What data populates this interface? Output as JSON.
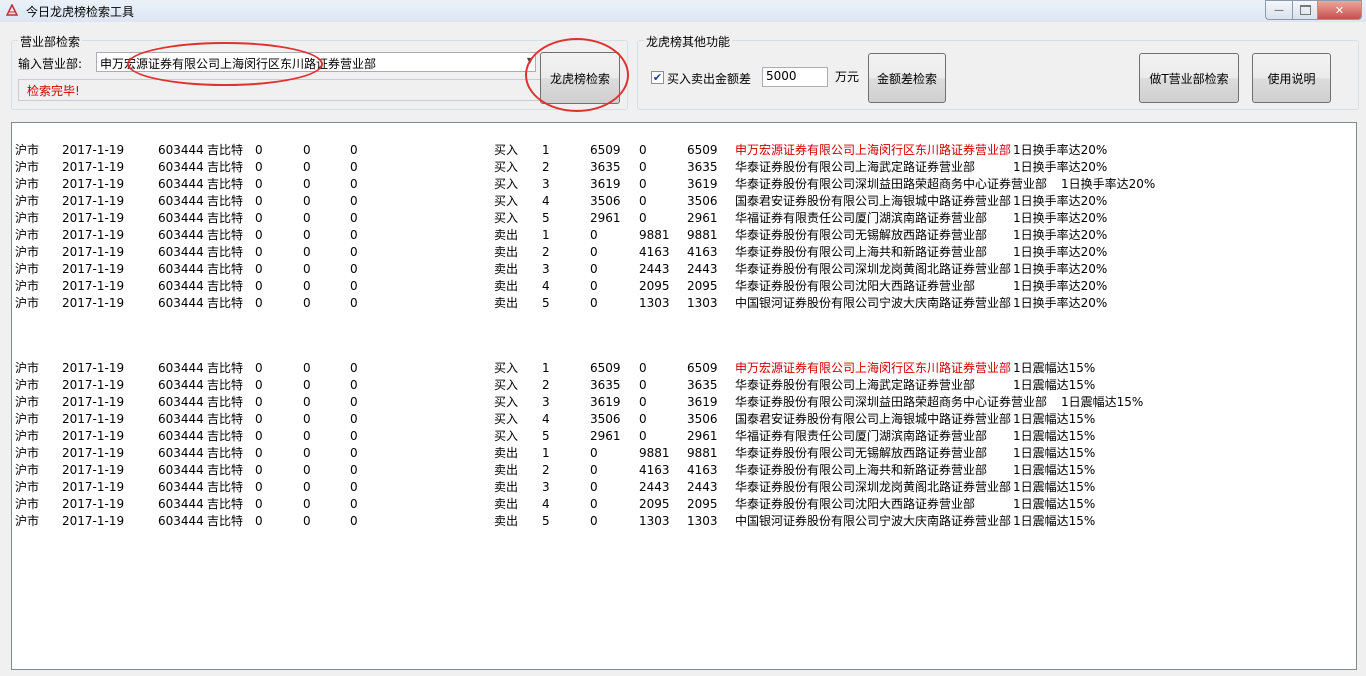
{
  "window": {
    "title": "今日龙虎榜检索工具",
    "close_glyph": "✕",
    "minimize_glyph": "—"
  },
  "branch_search": {
    "group_label": "营业部检索",
    "input_label": "输入营业部:",
    "input_value": "申万宏源证券有限公司上海闵行区东川路证券营业部",
    "search_button": "龙虎榜检索",
    "status_text": "检索完毕!"
  },
  "other_functions": {
    "group_label": "龙虎榜其他功能",
    "checkbox_label": "买入卖出金额差",
    "checkbox_checked": true,
    "amount_value": "5000",
    "amount_unit": "万元",
    "diff_search_button": "金额差检索",
    "t_branch_button": "做T营业部检索",
    "help_button": "使用说明"
  },
  "colors": {
    "highlight_branch": "#d00000",
    "annotation_circle": "#e03030"
  },
  "results": {
    "groups": [
      {
        "rows": [
          {
            "market": "沪市",
            "date": "2017-1-19",
            "code": "603444",
            "name": "吉比特",
            "z1": "0",
            "z2": "0",
            "z3": "0",
            "side": "买入",
            "rank": "1",
            "buy": "6509",
            "sell": "0",
            "net": "6509",
            "branch": "申万宏源证券有限公司上海闵行区东川路证券营业部",
            "reason": "1日换手率达20%",
            "highlight": true
          },
          {
            "market": "沪市",
            "date": "2017-1-19",
            "code": "603444",
            "name": "吉比特",
            "z1": "0",
            "z2": "0",
            "z3": "0",
            "side": "买入",
            "rank": "2",
            "buy": "3635",
            "sell": "0",
            "net": "3635",
            "branch": "华泰证券股份有限公司上海武定路证券营业部",
            "reason": "1日换手率达20%",
            "highlight": false
          },
          {
            "market": "沪市",
            "date": "2017-1-19",
            "code": "603444",
            "name": "吉比特",
            "z1": "0",
            "z2": "0",
            "z3": "0",
            "side": "买入",
            "rank": "3",
            "buy": "3619",
            "sell": "0",
            "net": "3619",
            "branch": "华泰证券股份有限公司深圳益田路荣超商务中心证券营业部",
            "reason": "1日换手率达20%",
            "highlight": false
          },
          {
            "market": "沪市",
            "date": "2017-1-19",
            "code": "603444",
            "name": "吉比特",
            "z1": "0",
            "z2": "0",
            "z3": "0",
            "side": "买入",
            "rank": "4",
            "buy": "3506",
            "sell": "0",
            "net": "3506",
            "branch": "国泰君安证券股份有限公司上海银城中路证券营业部",
            "reason": "1日换手率达20%",
            "highlight": false
          },
          {
            "market": "沪市",
            "date": "2017-1-19",
            "code": "603444",
            "name": "吉比特",
            "z1": "0",
            "z2": "0",
            "z3": "0",
            "side": "买入",
            "rank": "5",
            "buy": "2961",
            "sell": "0",
            "net": "2961",
            "branch": "华福证券有限责任公司厦门湖滨南路证券营业部",
            "reason": "1日换手率达20%",
            "highlight": false
          },
          {
            "market": "沪市",
            "date": "2017-1-19",
            "code": "603444",
            "name": "吉比特",
            "z1": "0",
            "z2": "0",
            "z3": "0",
            "side": "卖出",
            "rank": "1",
            "buy": "0",
            "sell": "9881",
            "net": "9881",
            "branch": "华泰证券股份有限公司无锡解放西路证券营业部",
            "reason": "1日换手率达20%",
            "highlight": false
          },
          {
            "market": "沪市",
            "date": "2017-1-19",
            "code": "603444",
            "name": "吉比特",
            "z1": "0",
            "z2": "0",
            "z3": "0",
            "side": "卖出",
            "rank": "2",
            "buy": "0",
            "sell": "4163",
            "net": "4163",
            "branch": "华泰证券股份有限公司上海共和新路证券营业部",
            "reason": "1日换手率达20%",
            "highlight": false
          },
          {
            "market": "沪市",
            "date": "2017-1-19",
            "code": "603444",
            "name": "吉比特",
            "z1": "0",
            "z2": "0",
            "z3": "0",
            "side": "卖出",
            "rank": "3",
            "buy": "0",
            "sell": "2443",
            "net": "2443",
            "branch": "华泰证券股份有限公司深圳龙岗黄阁北路证券营业部",
            "reason": "1日换手率达20%",
            "highlight": false
          },
          {
            "market": "沪市",
            "date": "2017-1-19",
            "code": "603444",
            "name": "吉比特",
            "z1": "0",
            "z2": "0",
            "z3": "0",
            "side": "卖出",
            "rank": "4",
            "buy": "0",
            "sell": "2095",
            "net": "2095",
            "branch": "华泰证券股份有限公司沈阳大西路证券营业部",
            "reason": "1日换手率达20%",
            "highlight": false
          },
          {
            "market": "沪市",
            "date": "2017-1-19",
            "code": "603444",
            "name": "吉比特",
            "z1": "0",
            "z2": "0",
            "z3": "0",
            "side": "卖出",
            "rank": "5",
            "buy": "0",
            "sell": "1303",
            "net": "1303",
            "branch": "中国银河证券股份有限公司宁波大庆南路证券营业部",
            "reason": "1日换手率达20%",
            "highlight": false
          }
        ]
      },
      {
        "rows": [
          {
            "market": "沪市",
            "date": "2017-1-19",
            "code": "603444",
            "name": "吉比特",
            "z1": "0",
            "z2": "0",
            "z3": "0",
            "side": "买入",
            "rank": "1",
            "buy": "6509",
            "sell": "0",
            "net": "6509",
            "branch": "申万宏源证券有限公司上海闵行区东川路证券营业部",
            "reason": "1日震幅达15%",
            "highlight": true
          },
          {
            "market": "沪市",
            "date": "2017-1-19",
            "code": "603444",
            "name": "吉比特",
            "z1": "0",
            "z2": "0",
            "z3": "0",
            "side": "买入",
            "rank": "2",
            "buy": "3635",
            "sell": "0",
            "net": "3635",
            "branch": "华泰证券股份有限公司上海武定路证券营业部",
            "reason": "1日震幅达15%",
            "highlight": false
          },
          {
            "market": "沪市",
            "date": "2017-1-19",
            "code": "603444",
            "name": "吉比特",
            "z1": "0",
            "z2": "0",
            "z3": "0",
            "side": "买入",
            "rank": "3",
            "buy": "3619",
            "sell": "0",
            "net": "3619",
            "branch": "华泰证券股份有限公司深圳益田路荣超商务中心证券营业部",
            "reason": "1日震幅达15%",
            "highlight": false
          },
          {
            "market": "沪市",
            "date": "2017-1-19",
            "code": "603444",
            "name": "吉比特",
            "z1": "0",
            "z2": "0",
            "z3": "0",
            "side": "买入",
            "rank": "4",
            "buy": "3506",
            "sell": "0",
            "net": "3506",
            "branch": "国泰君安证券股份有限公司上海银城中路证券营业部",
            "reason": "1日震幅达15%",
            "highlight": false
          },
          {
            "market": "沪市",
            "date": "2017-1-19",
            "code": "603444",
            "name": "吉比特",
            "z1": "0",
            "z2": "0",
            "z3": "0",
            "side": "买入",
            "rank": "5",
            "buy": "2961",
            "sell": "0",
            "net": "2961",
            "branch": "华福证券有限责任公司厦门湖滨南路证券营业部",
            "reason": "1日震幅达15%",
            "highlight": false
          },
          {
            "market": "沪市",
            "date": "2017-1-19",
            "code": "603444",
            "name": "吉比特",
            "z1": "0",
            "z2": "0",
            "z3": "0",
            "side": "卖出",
            "rank": "1",
            "buy": "0",
            "sell": "9881",
            "net": "9881",
            "branch": "华泰证券股份有限公司无锡解放西路证券营业部",
            "reason": "1日震幅达15%",
            "highlight": false
          },
          {
            "market": "沪市",
            "date": "2017-1-19",
            "code": "603444",
            "name": "吉比特",
            "z1": "0",
            "z2": "0",
            "z3": "0",
            "side": "卖出",
            "rank": "2",
            "buy": "0",
            "sell": "4163",
            "net": "4163",
            "branch": "华泰证券股份有限公司上海共和新路证券营业部",
            "reason": "1日震幅达15%",
            "highlight": false
          },
          {
            "market": "沪市",
            "date": "2017-1-19",
            "code": "603444",
            "name": "吉比特",
            "z1": "0",
            "z2": "0",
            "z3": "0",
            "side": "卖出",
            "rank": "3",
            "buy": "0",
            "sell": "2443",
            "net": "2443",
            "branch": "华泰证券股份有限公司深圳龙岗黄阁北路证券营业部",
            "reason": "1日震幅达15%",
            "highlight": false
          },
          {
            "market": "沪市",
            "date": "2017-1-19",
            "code": "603444",
            "name": "吉比特",
            "z1": "0",
            "z2": "0",
            "z3": "0",
            "side": "卖出",
            "rank": "4",
            "buy": "0",
            "sell": "2095",
            "net": "2095",
            "branch": "华泰证券股份有限公司沈阳大西路证券营业部",
            "reason": "1日震幅达15%",
            "highlight": false
          },
          {
            "market": "沪市",
            "date": "2017-1-19",
            "code": "603444",
            "name": "吉比特",
            "z1": "0",
            "z2": "0",
            "z3": "0",
            "side": "卖出",
            "rank": "5",
            "buy": "0",
            "sell": "1303",
            "net": "1303",
            "branch": "中国银河证券股份有限公司宁波大庆南路证券营业部",
            "reason": "1日震幅达15%",
            "highlight": false
          }
        ]
      }
    ]
  }
}
